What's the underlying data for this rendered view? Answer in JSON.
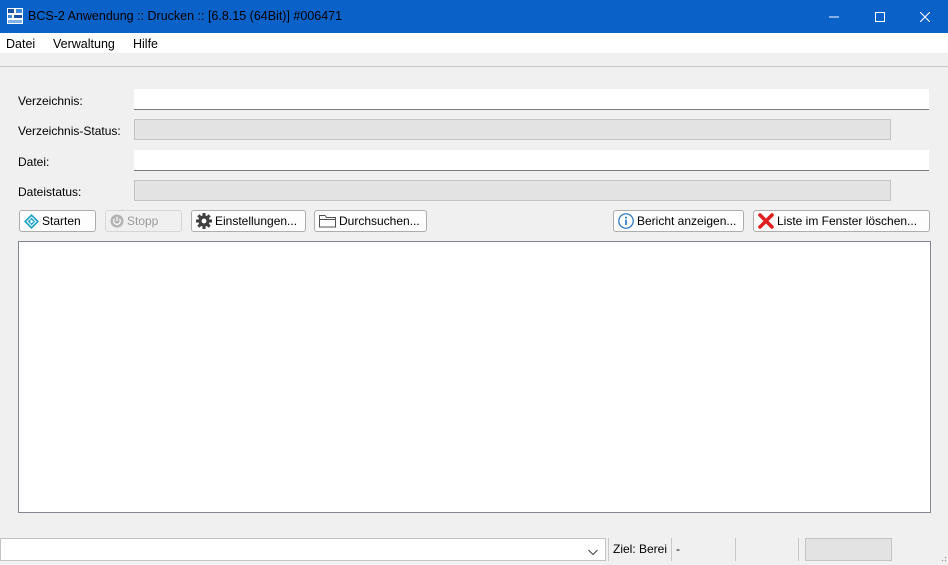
{
  "window": {
    "title": "BCS-2 Anwendung :: Drucken :: [6.8.15 (64Bit)]   #006471",
    "minimize_glyph": "—",
    "maximize_glyph": "☐",
    "close_glyph": "✕"
  },
  "menu": [
    "Datei",
    "Verwaltung",
    "Hilfe"
  ],
  "form": {
    "verzeichnis_label": "Verzeichnis:",
    "verzeichnis_value": "",
    "verzeichnis_status_label": "Verzeichnis-Status:",
    "verzeichnis_status_value": "",
    "datei_label": "Datei:",
    "datei_value": "",
    "dateistatus_label": "Dateistatus:",
    "dateistatus_value": ""
  },
  "toolbar": {
    "start_label": "Starten",
    "stop_label": "Stopp",
    "settings_label": "Einstellungen...",
    "browse_label": "Durchsuchen...",
    "report_label": "Bericht anzeigen...",
    "clear_label": "Liste im Fenster löschen..."
  },
  "status_bar": {
    "combo_value": "",
    "target_text": "Ziel: Berei",
    "target_value": "-"
  },
  "colors": {
    "titlebar": "#0a62c9",
    "start_icon": "#1aa3c4",
    "clear_icon": "#e02020",
    "info_icon": "#1e6fc7"
  },
  "icons": {
    "app": "bcs-app-icon",
    "start": "play-diamond-icon",
    "stop": "power-icon",
    "settings": "gear-icon",
    "browse": "folder-icon",
    "report": "info-icon",
    "clear": "red-x-icon",
    "combo": "chevron-down-icon"
  }
}
